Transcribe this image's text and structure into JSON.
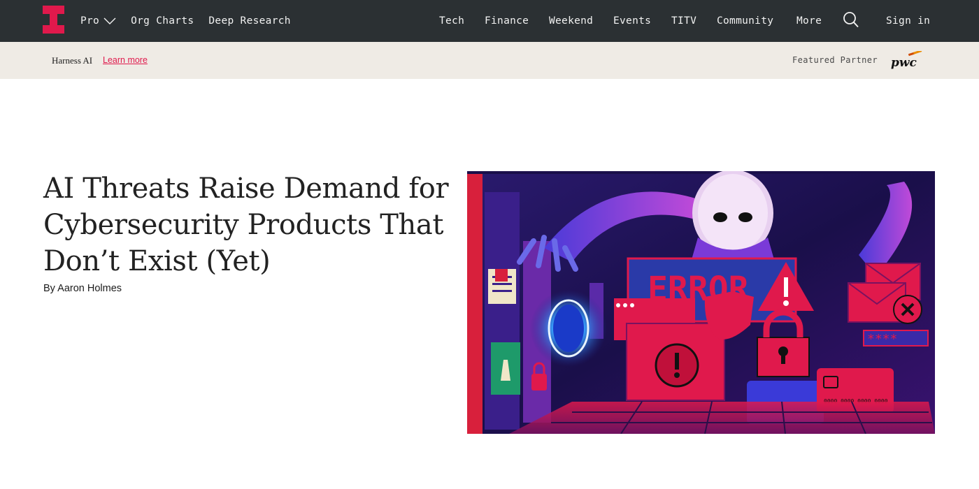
{
  "nav": {
    "pro_label": "Pro",
    "left_items": [
      "Org Charts",
      "Deep Research"
    ],
    "right_items": [
      "Tech",
      "Finance",
      "Weekend",
      "Events",
      "TITV",
      "Community",
      "More"
    ],
    "sign_in_label": "Sign in",
    "search_icon": "search-icon",
    "logo_icon": "the-information-logo"
  },
  "partner_bar": {
    "sponsor_text": "Harness AI",
    "learn_more_label": "Learn more",
    "featured_label": "Featured Partner",
    "partner_logo": "pwc-logo"
  },
  "article": {
    "headline": "AI Threats Raise Demand for Cybersecurity Products That Don’t Exist (Yet)",
    "byline_prefix": "By",
    "author": "Aaron Holmes",
    "hero_image_text": "ERROR",
    "hero_card_number": "0000 0000 0000 0000"
  },
  "colors": {
    "nav_bg": "#2b3033",
    "brand_red": "#e0194c",
    "partner_bg": "#efebe5"
  }
}
